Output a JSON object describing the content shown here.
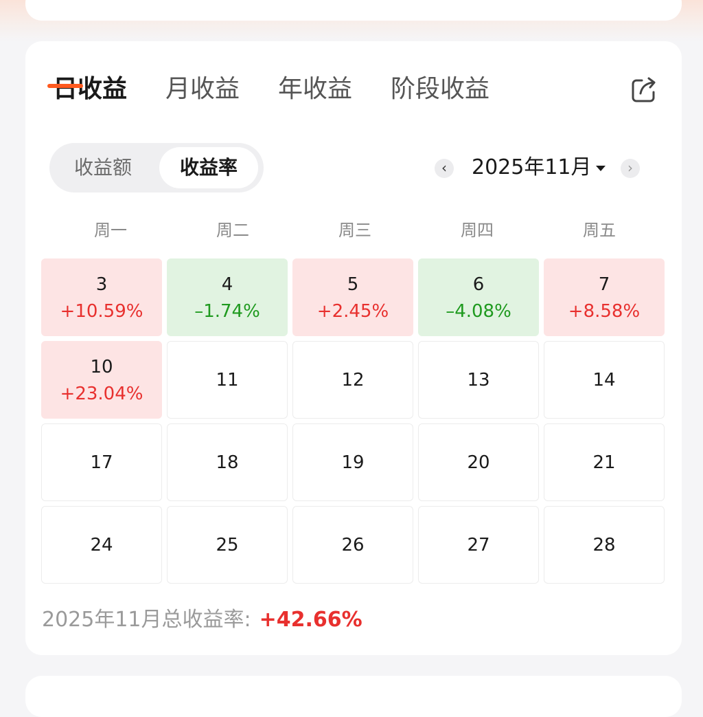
{
  "tabs": [
    {
      "label": "日收益",
      "active": true
    },
    {
      "label": "月收益",
      "active": false
    },
    {
      "label": "年收益",
      "active": false
    },
    {
      "label": "阶段收益",
      "active": false
    }
  ],
  "toggle": {
    "amount_label": "收益额",
    "rate_label": "收益率",
    "selected": "收益率"
  },
  "month_nav": {
    "prev_icon": "chevron-left-icon",
    "next_icon": "chevron-right-icon",
    "month": "2025年11月"
  },
  "weekdays": [
    "周一",
    "周二",
    "周三",
    "周四",
    "周五"
  ],
  "calendar": {
    "rows": [
      [
        {
          "day": "3",
          "value": "+10.59%",
          "trend": "up"
        },
        {
          "day": "4",
          "value": "–1.74%",
          "trend": "down"
        },
        {
          "day": "5",
          "value": "+2.45%",
          "trend": "up"
        },
        {
          "day": "6",
          "value": "–4.08%",
          "trend": "down"
        },
        {
          "day": "7",
          "value": "+8.58%",
          "trend": "up"
        }
      ],
      [
        {
          "day": "10",
          "value": "+23.04%",
          "trend": "up"
        },
        {
          "day": "11"
        },
        {
          "day": "12"
        },
        {
          "day": "13"
        },
        {
          "day": "14"
        }
      ],
      [
        {
          "day": "17"
        },
        {
          "day": "18"
        },
        {
          "day": "19"
        },
        {
          "day": "20"
        },
        {
          "day": "21"
        }
      ],
      [
        {
          "day": "24"
        },
        {
          "day": "25"
        },
        {
          "day": "26"
        },
        {
          "day": "27"
        },
        {
          "day": "28"
        }
      ]
    ]
  },
  "summary": {
    "label": "2025年11月总收益率:",
    "value": "+42.66%"
  },
  "colors": {
    "accent": "#ff5a1f",
    "gain": "#e8302e",
    "loss": "#1f9a1f",
    "gain_bg": "#fde4e4",
    "loss_bg": "#e1f3e1"
  },
  "icons": {
    "share": "share-icon"
  }
}
